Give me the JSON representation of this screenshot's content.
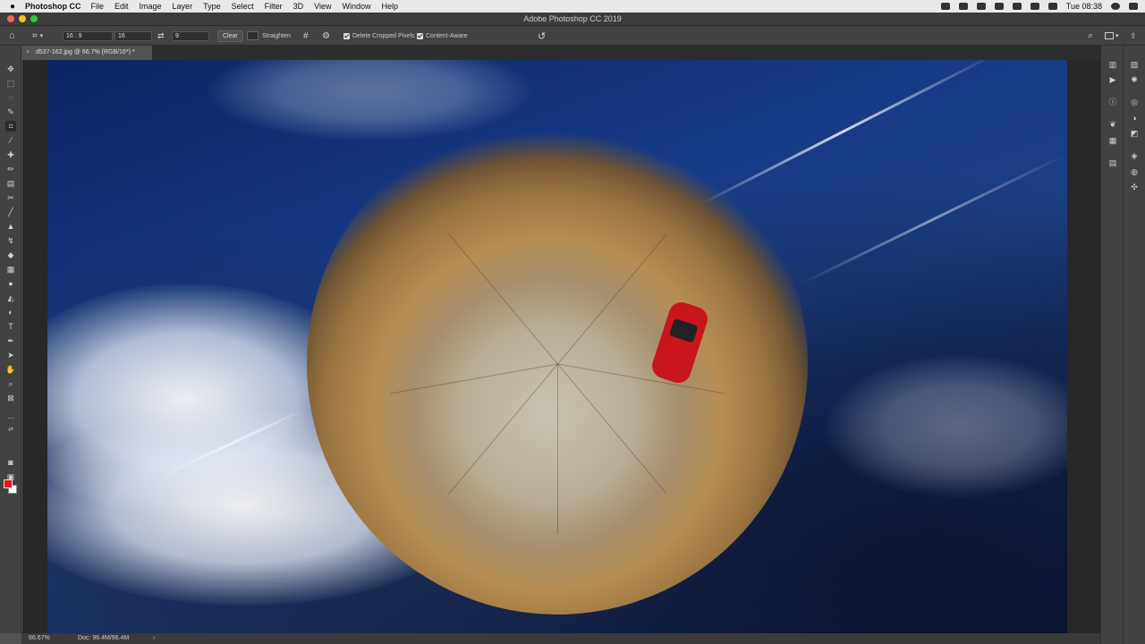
{
  "menubar": {
    "app": "Photoshop CC",
    "items": [
      "File",
      "Edit",
      "Image",
      "Layer",
      "Type",
      "Select",
      "Filter",
      "3D",
      "View",
      "Window",
      "Help"
    ],
    "clock": "Tue 08:38"
  },
  "window": {
    "title": "Adobe Photoshop CC 2019"
  },
  "options": {
    "ratio": "16 : 9",
    "width": "16",
    "height": "9",
    "clear": "Clear",
    "straighten": "Straighten",
    "delete_cropped": "Delete Cropped Pixels",
    "content_aware": "Content-Aware"
  },
  "document": {
    "tab": "d537-162.jpg @ 66.7% (RGB/16*) *"
  },
  "status": {
    "zoom": "66.67%",
    "doc": "Doc: 96.4M/96.4M",
    "arrow": "›"
  },
  "colors": {
    "foreground": "#e0161b",
    "background": "#ffffff"
  },
  "icons": {
    "apple": "",
    "home": "⌂",
    "crop": "⌗",
    "swap": "⇄",
    "undo": "↺",
    "search": "⌕"
  }
}
